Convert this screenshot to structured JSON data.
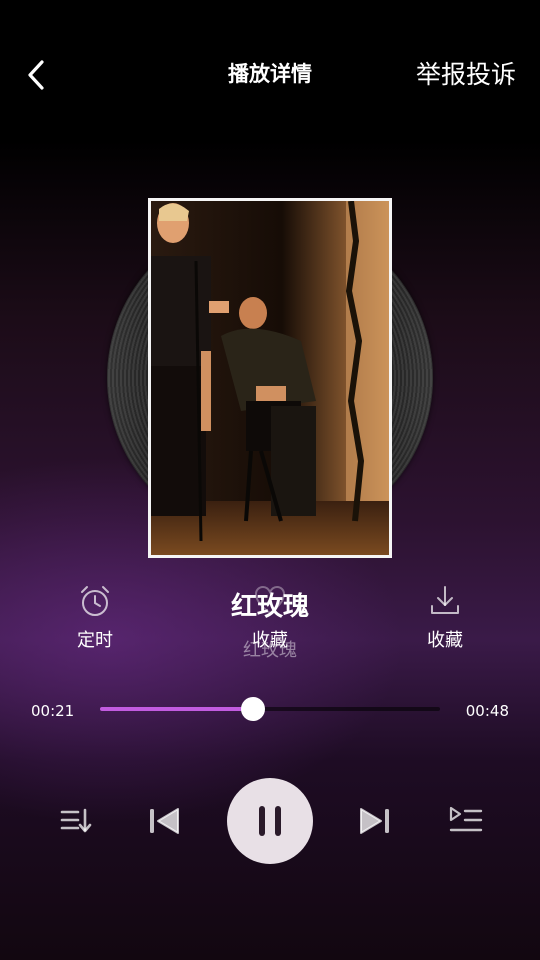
{
  "header": {
    "back_icon": "chevron-left-icon",
    "title": "播放详情",
    "report_label": "举报投诉"
  },
  "cover": {
    "description_icon": "album-cover-photo"
  },
  "actions": {
    "timer_label": "定时",
    "favorite_label": "收藏",
    "download_label": "收藏"
  },
  "song": {
    "title": "红玫瑰",
    "subtitle": "红玫瑰"
  },
  "progress": {
    "current": "00:21",
    "total": "00:48",
    "fraction": 0.45,
    "color": "#c25ce0"
  },
  "controls": {
    "playlist_icon": "playlist-order-icon",
    "prev_icon": "skip-previous-icon",
    "play_state_icon": "pause-icon",
    "next_icon": "skip-next-icon",
    "queue_icon": "queue-list-icon"
  }
}
